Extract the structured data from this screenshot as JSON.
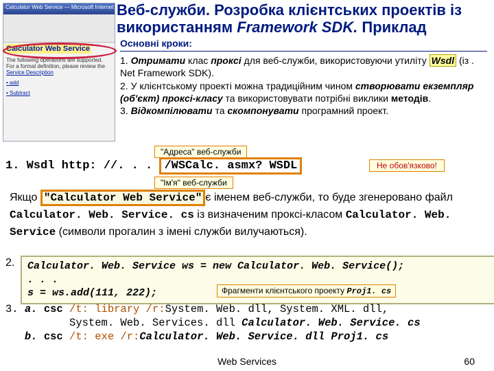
{
  "title_prefix": "Веб-служби. Розробка клієнтських проектів із використанням ",
  "title_em": "Framework SDK.",
  "title_suffix": " Приклад",
  "thumb": {
    "bar": "Calculator Web Service — Microsoft Internet Explorer",
    "link": "Calculator Web Service",
    "para": "The following operations are supported. For a formal definition, please review the",
    "sd": "Service Description",
    "op1": "• add",
    "op2": "• Subtract"
  },
  "steps_hdr": "Основні кроки:",
  "step1a": "1. ",
  "step1b": "Отримати",
  "step1c": " клас ",
  "step1d": "проксі",
  "step1e": " для веб-служби, використовуючи утиліту ",
  "step1w": "Wsdl",
  "step1f": " (із . Net Framework SDK).",
  "step2a": "2. У клієнтському проекті можна традиційним чином ",
  "step2b": "створювати екземпляр (об'єкт) проксі-класу",
  "step2c": " та використовувати потрібні виклики ",
  "step2d": "методів",
  "step2e": ".",
  "step3a": "3. ",
  "step3b": "Відкомпілювати",
  "step3c": " та ",
  "step3d": "скомпонувати",
  "step3e": " програмний проект.",
  "addr_label": "\"Адреса\" веб-служби",
  "name_label": "\"Ім'я\" веб-служби",
  "not_req": "Не обов'язково!",
  "line1_prefix": "1. Wsdl http: //. . .",
  "line1_addr": "/WSCalc. asmx? WSDL",
  "body_a": "Якщо ",
  "body_name": "\"Calculator Web Service\"",
  "body_b": "є іменем веб-служби, то буде згенеровано файл ",
  "body_file": "Calculator. Web. Service. cs",
  "body_c": " із визначеним проксі-класом ",
  "body_cls": "Calculator. Web. Service",
  "body_d": " (символи прогалин з імені служби вилучаються).",
  "num2": "2.",
  "code_l1": "Calculator. Web. Service ws = new Calculator. Web. Service();",
  "code_l2": "   . . .",
  "code_l3": "s = ws.add(111, 222);",
  "frag_a": "Фрагменти клієнтського проекту ",
  "frag_b": "Proj1. cs",
  "cmd3_a": "3. ",
  "cmd3_a1": "a.",
  "cmd3_a2": " csc",
  "cmd3_a3": " /t: library /r:",
  "cmd3_a4": "System. Web. dll, System. XML. dll,",
  "cmd3_a5": "System. Web. Services. dll ",
  "cmd3_a6": "Calculator. Web. Service. cs",
  "cmd3_b1": "b.",
  "cmd3_b2": " csc",
  "cmd3_b3": " /t: exe /r:",
  "cmd3_b4": "Calculator. Web. Service. dll Proj1. cs",
  "footer": "Web Services",
  "page": "60"
}
